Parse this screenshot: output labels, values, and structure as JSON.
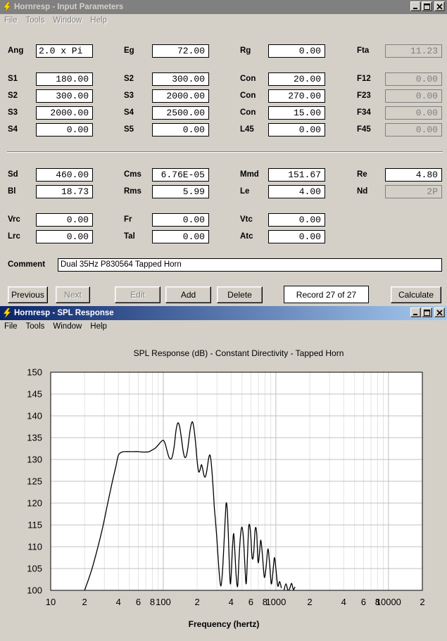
{
  "input_window": {
    "title": "Hornresp - Input Parameters",
    "menu": [
      "File",
      "Tools",
      "Window",
      "Help"
    ],
    "rows1": [
      [
        {
          "label": "Ang",
          "value": "2.0 x Pi",
          "align": "left"
        },
        {
          "label": "Eg",
          "value": "72.00"
        },
        {
          "label": "Rg",
          "value": "0.00"
        },
        {
          "label": "Fta",
          "value": "11.23",
          "ro": true
        }
      ]
    ],
    "rows2": [
      [
        {
          "label": "S1",
          "value": "180.00"
        },
        {
          "label": "S2",
          "value": "300.00"
        },
        {
          "label": "Con",
          "value": "20.00"
        },
        {
          "label": "F12",
          "value": "0.00",
          "ro": true
        }
      ],
      [
        {
          "label": "S2",
          "value": "300.00"
        },
        {
          "label": "S3",
          "value": "2000.00"
        },
        {
          "label": "Con",
          "value": "270.00"
        },
        {
          "label": "F23",
          "value": "0.00",
          "ro": true
        }
      ],
      [
        {
          "label": "S3",
          "value": "2000.00"
        },
        {
          "label": "S4",
          "value": "2500.00"
        },
        {
          "label": "Con",
          "value": "15.00"
        },
        {
          "label": "F34",
          "value": "0.00",
          "ro": true
        }
      ],
      [
        {
          "label": "S4",
          "value": "0.00"
        },
        {
          "label": "S5",
          "value": "0.00"
        },
        {
          "label": "L45",
          "value": "0.00"
        },
        {
          "label": "F45",
          "value": "0.00",
          "ro": true
        }
      ]
    ],
    "rows3": [
      [
        {
          "label": "Sd",
          "value": "460.00"
        },
        {
          "label": "Cms",
          "value": "6.76E-05"
        },
        {
          "label": "Mmd",
          "value": "151.67"
        },
        {
          "label": "Re",
          "value": "4.80"
        }
      ],
      [
        {
          "label": "Bl",
          "value": "18.73"
        },
        {
          "label": "Rms",
          "value": "5.99"
        },
        {
          "label": "Le",
          "value": "4.00"
        },
        {
          "label": "Nd",
          "value": "2P",
          "ro": true
        }
      ]
    ],
    "rows4": [
      [
        {
          "label": "Vrc",
          "value": "0.00"
        },
        {
          "label": "Fr",
          "value": "0.00"
        },
        {
          "label": "Vtc",
          "value": "0.00"
        }
      ],
      [
        {
          "label": "Lrc",
          "value": "0.00"
        },
        {
          "label": "Tal",
          "value": "0.00"
        },
        {
          "label": "Atc",
          "value": "0.00"
        }
      ]
    ],
    "comment_label": "Comment",
    "comment_value": "Dual 35Hz P830564 Tapped Horn",
    "buttons": {
      "previous": "Previous",
      "next": "Next",
      "edit": "Edit",
      "add": "Add",
      "delete": "Delete",
      "calculate": "Calculate"
    },
    "record_text": "Record 27 of 27"
  },
  "spl_window": {
    "title": "Hornresp - SPL Response",
    "menu": [
      "File",
      "Tools",
      "Window",
      "Help"
    ]
  },
  "colors": {
    "face": "#d4d0c8",
    "active_title_start": "#0a246a",
    "active_title_end": "#a6caf0",
    "inactive_title": "#808080",
    "plot_bg": "#ffffff",
    "major_grid": "#c0c0c0",
    "minor_grid": "#e4e4e4",
    "curve": "#000000"
  },
  "icons": {
    "app": "lightning-bolt-icon",
    "minimize": "minimize-icon",
    "maximize": "maximize-icon",
    "close": "close-icon"
  },
  "chart_data": {
    "type": "line",
    "title": "SPL Response (dB) - Constant Directivity - Tapped Horn",
    "xlabel": "Frequency (hertz)",
    "ylabel": "",
    "x_scale": "log",
    "xlim": [
      10,
      20000
    ],
    "ylim": [
      100,
      150
    ],
    "yticks": [
      100,
      105,
      110,
      115,
      120,
      125,
      130,
      135,
      140,
      145,
      150
    ],
    "xtick_labels": [
      {
        "x": 10,
        "label": "10"
      },
      {
        "x": 20,
        "label": "2"
      },
      {
        "x": 40,
        "label": "4"
      },
      {
        "x": 60,
        "label": "6"
      },
      {
        "x": 80,
        "label": "8"
      },
      {
        "x": 100,
        "label": "100"
      },
      {
        "x": 200,
        "label": "2"
      },
      {
        "x": 400,
        "label": "4"
      },
      {
        "x": 600,
        "label": "6"
      },
      {
        "x": 800,
        "label": "8"
      },
      {
        "x": 1000,
        "label": "1000"
      },
      {
        "x": 2000,
        "label": "2"
      },
      {
        "x": 4000,
        "label": "4"
      },
      {
        "x": 6000,
        "label": "6"
      },
      {
        "x": 8000,
        "label": "8"
      },
      {
        "x": 10000,
        "label": "10000"
      },
      {
        "x": 20000,
        "label": "2"
      }
    ],
    "grid": true,
    "legend": "none",
    "series": [
      {
        "x": [
          20,
          23,
          26,
          29,
          32,
          35,
          38,
          40,
          43,
          46,
          50,
          55,
          60,
          65,
          70,
          75,
          80,
          85,
          90,
          95,
          100,
          104,
          108,
          112,
          116,
          120,
          125,
          130,
          135,
          140,
          145,
          150,
          155,
          160,
          165,
          170,
          176,
          182,
          188,
          194,
          200,
          206,
          212,
          218,
          224,
          230,
          236,
          242,
          248,
          254,
          260,
          266,
          272,
          278,
          284,
          290,
          298,
          306,
          315,
          325,
          335,
          345,
          355,
          362,
          370,
          378,
          386,
          394,
          402,
          412,
          422,
          432,
          445,
          458,
          470,
          485,
          500,
          515,
          530,
          545,
          560,
          575,
          595,
          615,
          635,
          655,
          675,
          695,
          715,
          735,
          760,
          790,
          820,
          850,
          880,
          910,
          940,
          970,
          1000,
          1040,
          1080,
          1120
        ],
        "y": [
          100.0,
          104.5,
          109.5,
          114.5,
          119.8,
          124.5,
          128.5,
          131.0,
          131.7,
          131.8,
          131.8,
          131.8,
          131.8,
          131.7,
          131.7,
          131.8,
          132.2,
          132.6,
          133.3,
          134.0,
          134.4,
          133.6,
          132.0,
          130.6,
          130.1,
          130.6,
          133.0,
          136.8,
          138.4,
          137.4,
          134.8,
          132.0,
          130.5,
          130.8,
          132.5,
          135.2,
          137.8,
          138.6,
          136.8,
          133.5,
          129.6,
          127.2,
          127.6,
          128.8,
          127.8,
          126.3,
          126.0,
          127.0,
          128.8,
          130.5,
          131.0,
          129.5,
          126.5,
          123.0,
          119.0,
          116.3,
          112.5,
          108.0,
          103.5,
          101.0,
          104.0,
          110.0,
          116.5,
          120.0,
          118.5,
          113.0,
          106.0,
          101.5,
          104.0,
          110.0,
          113.0,
          109.0,
          103.0,
          101.0,
          107.0,
          112.5,
          114.5,
          112.0,
          106.0,
          101.5,
          108.0,
          114.8,
          113.5,
          107.5,
          108.5,
          114.0,
          113.2,
          106.5,
          108.5,
          111.5,
          108.0,
          103.0,
          105.5,
          109.5,
          106.0,
          101.5,
          104.0,
          107.5,
          105.0,
          101.0,
          102.0,
          100.5
        ]
      },
      {
        "x": [
          1180,
          1230,
          1280,
          1330,
          1380,
          1430,
          1480
        ],
        "y": [
          100.0,
          101.5,
          100.0,
          100.5,
          101.6,
          100.2,
          100.8
        ]
      }
    ]
  }
}
